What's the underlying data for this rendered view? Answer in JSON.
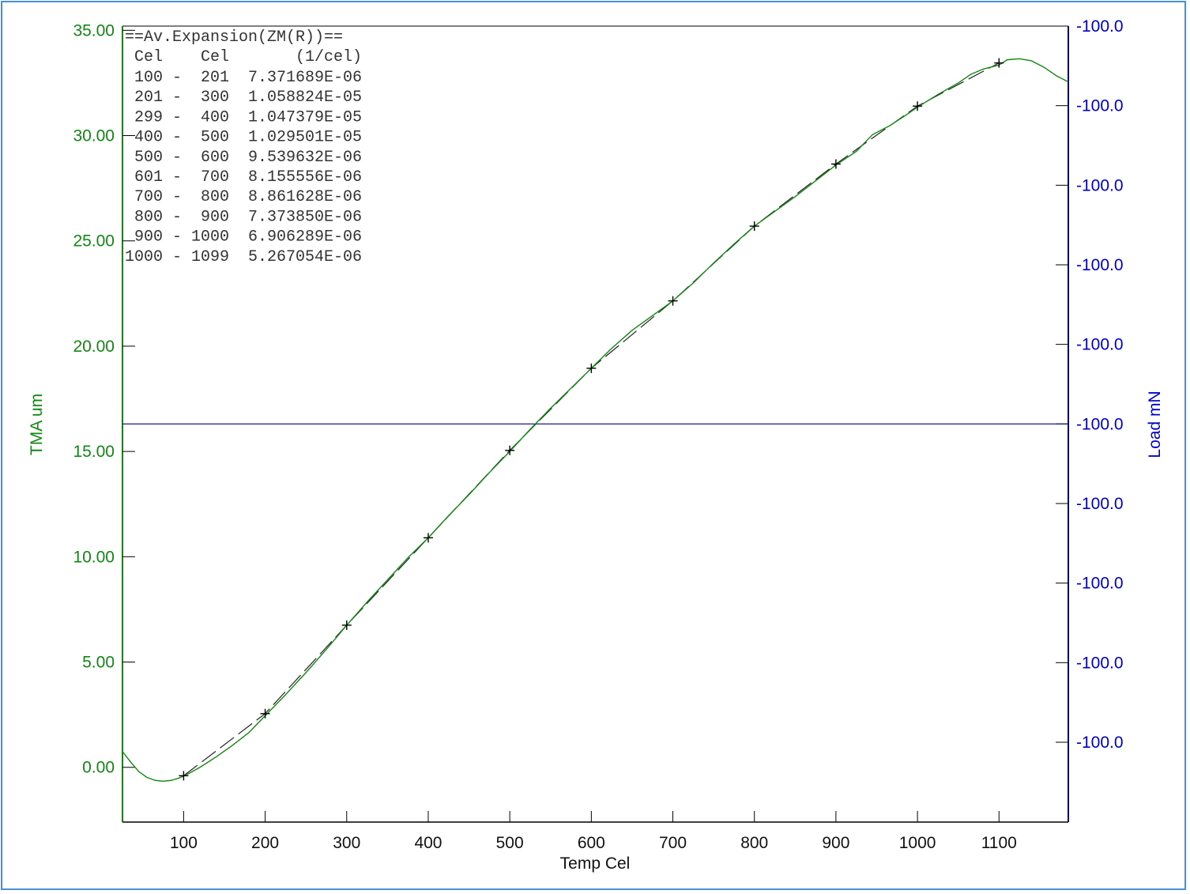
{
  "chart_data": {
    "type": "line",
    "xlabel": "Temp Cel",
    "ylabel_left": "TMA um",
    "ylabel_right": "Load mN",
    "xlim": [
      25,
      1185
    ],
    "ylim_left": [
      -2.6,
      35.2
    ],
    "x_ticks": [
      100,
      200,
      300,
      400,
      500,
      600,
      700,
      800,
      900,
      1000,
      1100
    ],
    "y_ticks_left": [
      "35.00",
      "30.00",
      "25.00",
      "20.00",
      "15.00",
      "10.00",
      "5.00",
      "0.00"
    ],
    "y_ticks_left_values": [
      35,
      30,
      25,
      20,
      15,
      10,
      5,
      0
    ],
    "y_ticks_right": [
      "-100.0",
      "-100.0",
      "-100.0",
      "-100.0",
      "-100.0",
      "-100.0",
      "-100.0",
      "-100.0",
      "-100.0",
      "-100.0"
    ],
    "colors": {
      "tma": "#118811",
      "load": "#000080",
      "markers": "#000000",
      "left_axis": "#118811",
      "right_axis": "#000080",
      "frame": "#4a90d9"
    },
    "series": [
      {
        "name": "TMA um",
        "points": [
          [
            25,
            0.75
          ],
          [
            35,
            0.25
          ],
          [
            45,
            -0.2
          ],
          [
            55,
            -0.48
          ],
          [
            65,
            -0.62
          ],
          [
            75,
            -0.66
          ],
          [
            85,
            -0.62
          ],
          [
            95,
            -0.5
          ],
          [
            105,
            -0.32
          ],
          [
            120,
            0.0
          ],
          [
            140,
            0.5
          ],
          [
            160,
            1.05
          ],
          [
            180,
            1.65
          ],
          [
            200,
            2.45
          ],
          [
            225,
            3.45
          ],
          [
            250,
            4.5
          ],
          [
            275,
            5.6
          ],
          [
            300,
            6.75
          ],
          [
            325,
            7.85
          ],
          [
            350,
            8.9
          ],
          [
            375,
            9.95
          ],
          [
            400,
            10.9
          ],
          [
            425,
            11.95
          ],
          [
            450,
            12.95
          ],
          [
            475,
            14.0
          ],
          [
            500,
            15.0
          ],
          [
            525,
            16.05
          ],
          [
            550,
            17.05
          ],
          [
            575,
            18.0
          ],
          [
            600,
            18.95
          ],
          [
            625,
            19.9
          ],
          [
            650,
            20.75
          ],
          [
            675,
            21.45
          ],
          [
            700,
            22.15
          ],
          [
            725,
            23.0
          ],
          [
            750,
            23.95
          ],
          [
            775,
            24.85
          ],
          [
            800,
            25.7
          ],
          [
            825,
            26.4
          ],
          [
            850,
            27.1
          ],
          [
            875,
            27.85
          ],
          [
            900,
            28.6
          ],
          [
            925,
            29.25
          ],
          [
            945,
            30.05
          ],
          [
            965,
            30.45
          ],
          [
            985,
            30.95
          ],
          [
            1000,
            31.35
          ],
          [
            1025,
            31.95
          ],
          [
            1050,
            32.5
          ],
          [
            1065,
            32.9
          ],
          [
            1080,
            33.15
          ],
          [
            1100,
            33.35
          ],
          [
            1110,
            33.6
          ],
          [
            1125,
            33.65
          ],
          [
            1140,
            33.55
          ],
          [
            1155,
            33.25
          ],
          [
            1170,
            32.85
          ],
          [
            1185,
            32.55
          ]
        ]
      },
      {
        "name": "Av.Expansion",
        "x": [
          100,
          200,
          300,
          400,
          500,
          600,
          700,
          800,
          900,
          1000,
          1100
        ],
        "y": [
          -0.4,
          2.55,
          6.75,
          10.9,
          15.05,
          18.95,
          22.15,
          25.7,
          28.65,
          31.4,
          33.45
        ]
      },
      {
        "name": "Load mN",
        "constant_at_right_tick": 5
      }
    ],
    "legend": {
      "title": "==Av.Expansion(ZM(R))==",
      "header": " Cel    Cel       (1/cel)",
      "rows": [
        " 100 -  201  7.371689E-06",
        " 201 -  300  1.058824E-05",
        " 299 -  400  1.047379E-05",
        " 400 -  500  1.029501E-05",
        " 500 -  600  9.539632E-06",
        " 601 -  700  8.155556E-06",
        " 700 -  800  8.861628E-06",
        " 800 -  900  7.373850E-06",
        " 900 - 1000  6.906289E-06",
        "1000 - 1099  5.267054E-06"
      ],
      "position": "top-left"
    }
  }
}
